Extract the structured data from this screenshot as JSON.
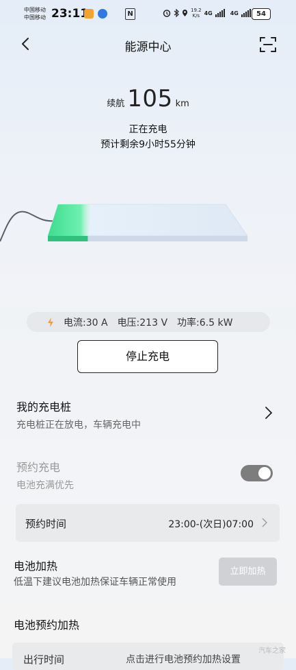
{
  "status_bar": {
    "carrier1": "中国移动",
    "carrier2": "中国移动",
    "time": "23:11",
    "nfc": "N",
    "speed_value": "19.2",
    "speed_unit": "K/s",
    "net1": "4G",
    "net2": "4G",
    "battery": "54"
  },
  "header": {
    "title": "能源中心"
  },
  "summary": {
    "range_label": "续航",
    "range_value": "105",
    "range_unit": "km",
    "charge_status": "正在充电",
    "remaining": "预计剩余9小时55分钟",
    "battery_level": 0.2
  },
  "metrics": {
    "current": "电流:30 A",
    "voltage": "电压:213 V",
    "power": "功率:6.5 kW"
  },
  "stop_button": "停止充电",
  "my_pile": {
    "title": "我的充电桩",
    "subtitle": "充电桩正在放电，车辆充电中"
  },
  "scheduled": {
    "title": "预约充电",
    "subtitle": "电池充满优先",
    "enabled": true,
    "time_label": "预约时间",
    "time_value": "23:00-(次日)07:00"
  },
  "heating": {
    "title": "电池加热",
    "subtitle": "低温下建议电池加热保证车辆正常使用",
    "button": "立即加热"
  },
  "preheat": {
    "title": "电池预约加热",
    "row_label": "出行时间",
    "row_value": "点击进行电池预约加热设置"
  },
  "watermark": "汽车之家",
  "colors": {
    "charge_green": "#3ddc8e",
    "toggle_on": "#7d7d7d",
    "bolt": "#f39a3a"
  }
}
